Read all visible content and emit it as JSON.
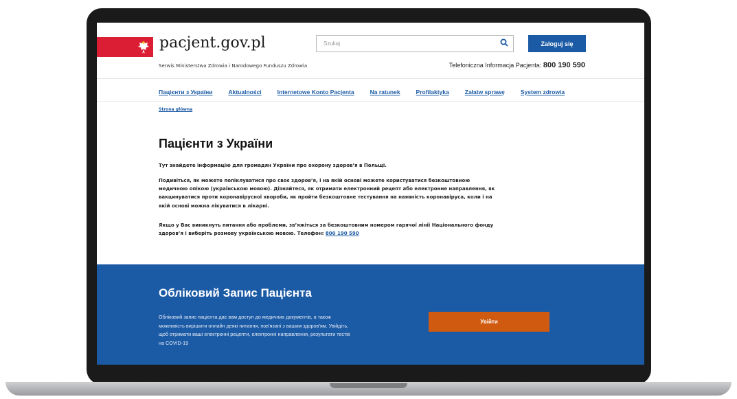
{
  "header": {
    "logo_text": "pacjent.gov.pl",
    "tagline": "Serwis Ministerstwa Zdrowia i Narodowego Funduszu Zdrowia",
    "search_placeholder": "Szukaj",
    "login_label": "Zaloguj się",
    "hotline_label": "Telefoniczna Informacja Pacjenta:",
    "hotline_number": "800 190 590"
  },
  "nav": {
    "items": [
      "Пацієнти з України",
      "Aktualności",
      "Internetowe Konto Pacjenta",
      "Na ratunek",
      "Profilaktyka",
      "Załatw sprawę",
      "System zdrowia"
    ]
  },
  "breadcrumb": "Strona główna",
  "main": {
    "title": "Пацієнти з України",
    "p1": "Тут знайдете інформацію для громадян України про охорону здоров’я в Польщі.",
    "p2": "Подивіться, як можете попіклуватися про своє здоров’я, і на якій основі можете користуватися безкоштовною медичною опікою (українською мовою). Дізнайтеся, як отримати електронний рецепт або електронне направлення, як вакцинуватися проти коронавірусної хвороби, як пройти безкоштовне тестування на наявність коронавіруса, коли і на якій основі можна лікуватися в лікарні.",
    "p3": "Якщо у Вас виникнуть питання або проблеми, зв’яжіться за безкоштовним номером гарячої лінії Національного фонду здоров’я і виберіть розмову українською мовою. Телефон:",
    "phone": "800 190 590"
  },
  "account": {
    "title": "Обліковий Запис Пацієнта",
    "text": "Обліковий запис пацієнта дає вам доступ до медичних документів, а також можливість вирішити онлайн деякі питання, пов’язані з вашим здоров’ям. Увійдіть, щоб отримати ваші електронні рецепти, електронні направлення, результати тестів на COVID-19",
    "button_label": "Увійти"
  },
  "icons": {
    "search": "search-icon",
    "emblem": "polish-eagle-icon"
  },
  "colors": {
    "primary": "#1b5aa5",
    "flag_red": "#dc1e35",
    "cta": "#d05a10"
  }
}
